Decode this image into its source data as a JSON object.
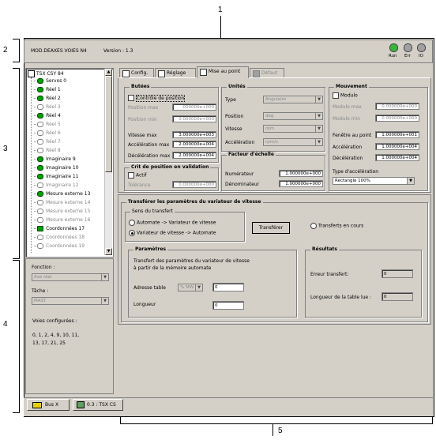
{
  "callouts": {
    "c1": "1",
    "c2": "2",
    "c3": "3",
    "c4": "4",
    "c5": "5"
  },
  "header": {
    "module": "MOD.DEAXES VOIES N4",
    "version": "Version : 1.3",
    "leds": [
      {
        "label": "Run",
        "color": "#3cb43c"
      },
      {
        "label": "Err",
        "color": "#a0a0a0"
      },
      {
        "label": "IO",
        "color": "#a0a0a0"
      }
    ]
  },
  "tree": {
    "root": "TSX CSY 84",
    "items": [
      {
        "label": "Servos 0",
        "state": "on"
      },
      {
        "label": "Réel 1",
        "state": "on"
      },
      {
        "label": "Réel 2",
        "state": "on"
      },
      {
        "label": "Réel 3",
        "state": "off"
      },
      {
        "label": "Réel 4",
        "state": "on"
      },
      {
        "label": "Réel 5",
        "state": "off"
      },
      {
        "label": "Réel 6",
        "state": "off"
      },
      {
        "label": "Réel 7",
        "state": "off"
      },
      {
        "label": "Réel 8",
        "state": "off"
      },
      {
        "label": "Imaginaire 9",
        "state": "on"
      },
      {
        "label": "Imaginaire 10",
        "state": "on"
      },
      {
        "label": "Imaginaire 11",
        "state": "on"
      },
      {
        "label": "Imaginaire 12",
        "state": "off"
      },
      {
        "label": "Mesure externe 13",
        "state": "on"
      },
      {
        "label": "Mesure externe 14",
        "state": "off"
      },
      {
        "label": "Mesure externe 15",
        "state": "off"
      },
      {
        "label": "Mesure externe 16",
        "state": "off"
      },
      {
        "label": "Coordonnées 17",
        "state": "sq"
      },
      {
        "label": "Coordonnées 18",
        "state": "off"
      },
      {
        "label": "Coordonnées 19",
        "state": "off"
      }
    ]
  },
  "left_panel": {
    "function_label": "Fonction :",
    "function_value": "Axe réel",
    "task_label": "Tâche :",
    "task_value": "MAST",
    "configured_label": "Voies configurées :",
    "configured_line1": "0, 1, 2, 4, 9, 10, 11,",
    "configured_line2": "13, 17, 21, 25"
  },
  "tabs": [
    {
      "label": "Config."
    },
    {
      "label": "Réglage"
    },
    {
      "label": "Mise au point"
    },
    {
      "label": "Défaut"
    }
  ],
  "butees": {
    "title": "Butées",
    "check": "Contrôle de position",
    "pos_max_label": "Position max",
    "pos_max": ".000000e+000",
    "pos_min_label": "Position min",
    "pos_min": "0.000000e+000",
    "vmax_label": "Vitesse max",
    "vmax": "3.000000e+003",
    "amax_label": "Accélération max",
    "amax": "2.000000e+004",
    "dmax_label": "Décélération max",
    "dmax": "2.000000e+004"
  },
  "crit": {
    "title": "Crit de position en validation",
    "check": "Actif",
    "tol_label": "Tolérance",
    "tol": "0.000000e+000"
  },
  "unites": {
    "title": "Unités",
    "type_label": "Type",
    "type_value": "Angulaire",
    "pos_label": "Position",
    "pos_value": "deg",
    "vit_label": "Vitesse",
    "vit_value": "rpm",
    "acc_label": "Accélération",
    "acc_value": "rpm/s"
  },
  "echelle": {
    "title": "Facteur d'échelle",
    "num_label": "Numérateur",
    "num": "1.000000e+000",
    "den_label": "Dénominateur",
    "den": "1.000000e+000"
  },
  "mouvement": {
    "title": "Mouvement",
    "check": "Modulo",
    "mmax_label": "Modulo max",
    "mmax": "0.000000e+000",
    "mmin_label": "Modulo min",
    "mmin": "0.000000e+000",
    "fen_label": "Fenêtre au point",
    "fen": "1.000000e+001",
    "acc_label": "Accélération",
    "acc": "1.000000e+004",
    "dec_label": "Décélération",
    "dec": "1.000000e+004",
    "type_label": "Type d'accélération",
    "type_value": "Rectangle 100%"
  },
  "transfer": {
    "title": "Transférer les paramètres du variateur de vitesse",
    "sens_title": "Sens du transfert",
    "opt1": "Automate -> Variateur de vitesse",
    "opt2": "Variateur de vitesse -> Automate",
    "button": "Transférer",
    "status": "Transferts en cours"
  },
  "params": {
    "title": "Paramètres",
    "desc1": "Transfert des paramètres du variateur de vitesse",
    "desc2": "à partir de la mémoire automate",
    "table_label": "Adresse table",
    "table_prefix": "% MW",
    "table_value": "0",
    "len_label": "Longueur",
    "len_value": "0"
  },
  "results": {
    "title": "Résultats",
    "err_label": "Erreur transfert:",
    "err_value": "0",
    "len_label": "Longueur de la table lue :",
    "len_value": "0"
  },
  "bottom_tabs": [
    {
      "label": "Bus X"
    },
    {
      "label": "0.3 : TSX CS"
    }
  ]
}
